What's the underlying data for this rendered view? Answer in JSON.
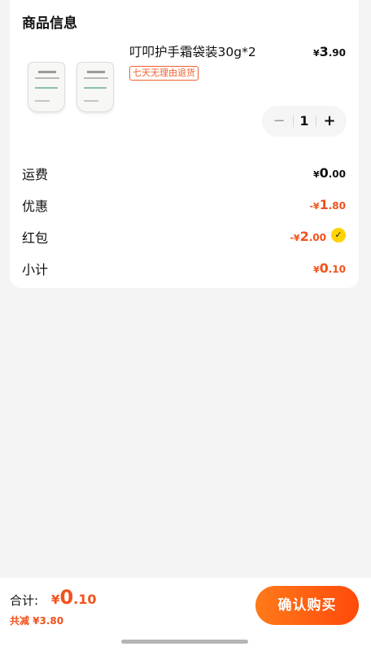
{
  "product_section": {
    "title": "商品信息",
    "product": {
      "name": "叮叩护手霜袋装30g*2",
      "price": {
        "currency": "¥",
        "int": "3",
        "dec": ".90"
      },
      "tag": "七天无理由退货",
      "quantity": "1",
      "image_icon": "hand-cream-pouches"
    }
  },
  "summary": {
    "shipping": {
      "label": "运费",
      "currency": "¥",
      "int": "0",
      "dec": ".00"
    },
    "discount": {
      "label": "优惠",
      "currency": "-¥",
      "int": "1",
      "dec": ".80"
    },
    "red_packet": {
      "label": "红包",
      "currency": "-¥",
      "int": "2",
      "dec": ".00",
      "checked": true
    },
    "subtotal": {
      "label": "小计",
      "currency": "¥",
      "int": "0",
      "dec": ".10"
    }
  },
  "footer": {
    "total_label": "合计:",
    "total": {
      "currency": "¥",
      "int": "0",
      "dec": ".10"
    },
    "saved_text": "共减 ¥3.80",
    "buy_button": "确认购买"
  },
  "colors": {
    "accent": "#f2521c",
    "check": "#ffd400"
  }
}
